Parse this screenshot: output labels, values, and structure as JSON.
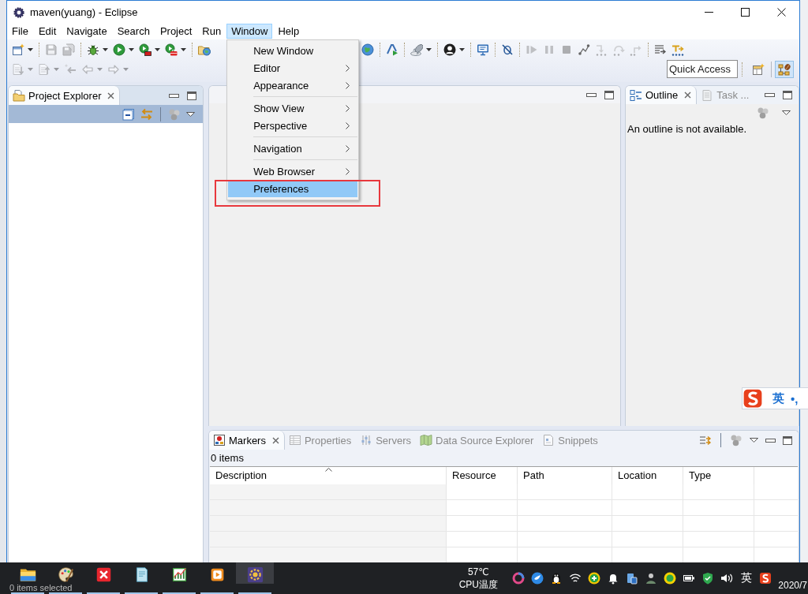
{
  "window": {
    "title": "maven(yuang) - Eclipse"
  },
  "menu_bar": [
    {
      "label": "File",
      "selected": false
    },
    {
      "label": "Edit",
      "selected": false
    },
    {
      "label": "Navigate",
      "selected": false
    },
    {
      "label": "Search",
      "selected": false
    },
    {
      "label": "Project",
      "selected": false
    },
    {
      "label": "Run",
      "selected": false
    },
    {
      "label": "Window",
      "selected": true
    },
    {
      "label": "Help",
      "selected": false
    }
  ],
  "window_menu": {
    "groups": [
      [
        {
          "label": "New Window",
          "submenu": false,
          "selected": false,
          "marked": false
        },
        {
          "label": "Editor",
          "submenu": true,
          "selected": false,
          "marked": false
        },
        {
          "label": "Appearance",
          "submenu": true,
          "selected": false,
          "marked": false
        }
      ],
      [
        {
          "label": "Show View",
          "submenu": true,
          "selected": false,
          "marked": false
        },
        {
          "label": "Perspective",
          "submenu": true,
          "selected": false,
          "marked": false
        }
      ],
      [
        {
          "label": "Navigation",
          "submenu": true,
          "selected": false,
          "marked": false
        }
      ],
      [
        {
          "label": "Web Browser",
          "submenu": true,
          "selected": false,
          "marked": false
        },
        {
          "label": "Preferences",
          "submenu": false,
          "selected": true,
          "marked": true
        }
      ]
    ]
  },
  "toolbar": {
    "row_1_left": [
      [
        {
          "disabled": false,
          "dropdown": true
        }
      ],
      [
        {
          "disabled": true,
          "dropdown": false
        },
        {
          "disabled": true,
          "dropdown": false
        }
      ],
      [
        {
          "disabled": false,
          "dropdown": true
        },
        {
          "disabled": false,
          "dropdown": true
        },
        {
          "disabled": false,
          "dropdown": true
        },
        {
          "disabled": false,
          "dropdown": true
        }
      ],
      [
        {
          "disabled": false,
          "dropdown": false
        }
      ]
    ],
    "row_1_right": [
      [
        {
          "disabled": false,
          "dropdown": false
        }
      ],
      [
        {
          "disabled": false,
          "dropdown": false
        }
      ],
      [
        {
          "disabled": false,
          "dropdown": true
        }
      ],
      [
        {
          "disabled": false,
          "dropdown": true
        }
      ],
      [
        {
          "disabled": false,
          "dropdown": false
        }
      ],
      [
        {
          "disabled": false,
          "dropdown": false
        }
      ],
      [
        {
          "disabled": true,
          "dropdown": false
        },
        {
          "disabled": true,
          "dropdown": false
        },
        {
          "disabled": true,
          "dropdown": false
        },
        {
          "disabled": false,
          "dropdown": false
        },
        {
          "disabled": true,
          "dropdown": false
        },
        {
          "disabled": true,
          "dropdown": false
        },
        {
          "disabled": true,
          "dropdown": false
        }
      ],
      [
        {
          "disabled": false,
          "dropdown": false
        },
        {
          "disabled": false,
          "dropdown": false
        }
      ]
    ],
    "row_2": [
      [
        {
          "disabled": true,
          "dropdown": true
        },
        {
          "disabled": true,
          "dropdown": true
        },
        {
          "disabled": true,
          "dropdown": false
        },
        {
          "disabled": true,
          "dropdown": true
        },
        {
          "disabled": true,
          "dropdown": true
        }
      ]
    ]
  },
  "quick_access": {
    "placeholder": "Quick Access"
  },
  "perspectives": [
    {
      "kind": "open",
      "selected": false
    },
    {
      "kind": "java-ee",
      "selected": true
    }
  ],
  "project_explorer": {
    "tabs": [
      {
        "label": "Project Explorer",
        "selected": true
      }
    ]
  },
  "outline": {
    "tabs": [
      {
        "label": "Outline",
        "selected": true
      },
      {
        "label": "Task ...",
        "selected": false
      }
    ],
    "message": "An outline is not available."
  },
  "markers": {
    "tabs": [
      {
        "label": "Markers",
        "selected": true
      },
      {
        "label": "Properties",
        "selected": false
      },
      {
        "label": "Servers",
        "selected": false
      },
      {
        "label": "Data Source Explorer",
        "selected": false
      },
      {
        "label": "Snippets",
        "selected": false
      }
    ],
    "summary": "0 items",
    "columns": [
      {
        "label": "Description",
        "sorted": true
      },
      {
        "label": "Resource",
        "sorted": false
      },
      {
        "label": "Path",
        "sorted": false
      },
      {
        "label": "Location",
        "sorted": false
      },
      {
        "label": "Type",
        "sorted": false
      }
    ]
  },
  "ime_bar": {
    "mode": "英",
    "punctuation": "•,"
  },
  "taskbar": {
    "apps": [
      {
        "selected": false,
        "running": true
      },
      {
        "selected": false,
        "running": true
      },
      {
        "selected": false,
        "running": true
      },
      {
        "selected": false,
        "running": true
      },
      {
        "selected": false,
        "running": true
      },
      {
        "selected": false,
        "running": true
      },
      {
        "selected": true,
        "running": true
      }
    ],
    "status_text": "0 items selected",
    "cpu_temperature": "57℃",
    "cpu_label": "CPU温度",
    "input_language": "英",
    "clock": "2020/7"
  }
}
